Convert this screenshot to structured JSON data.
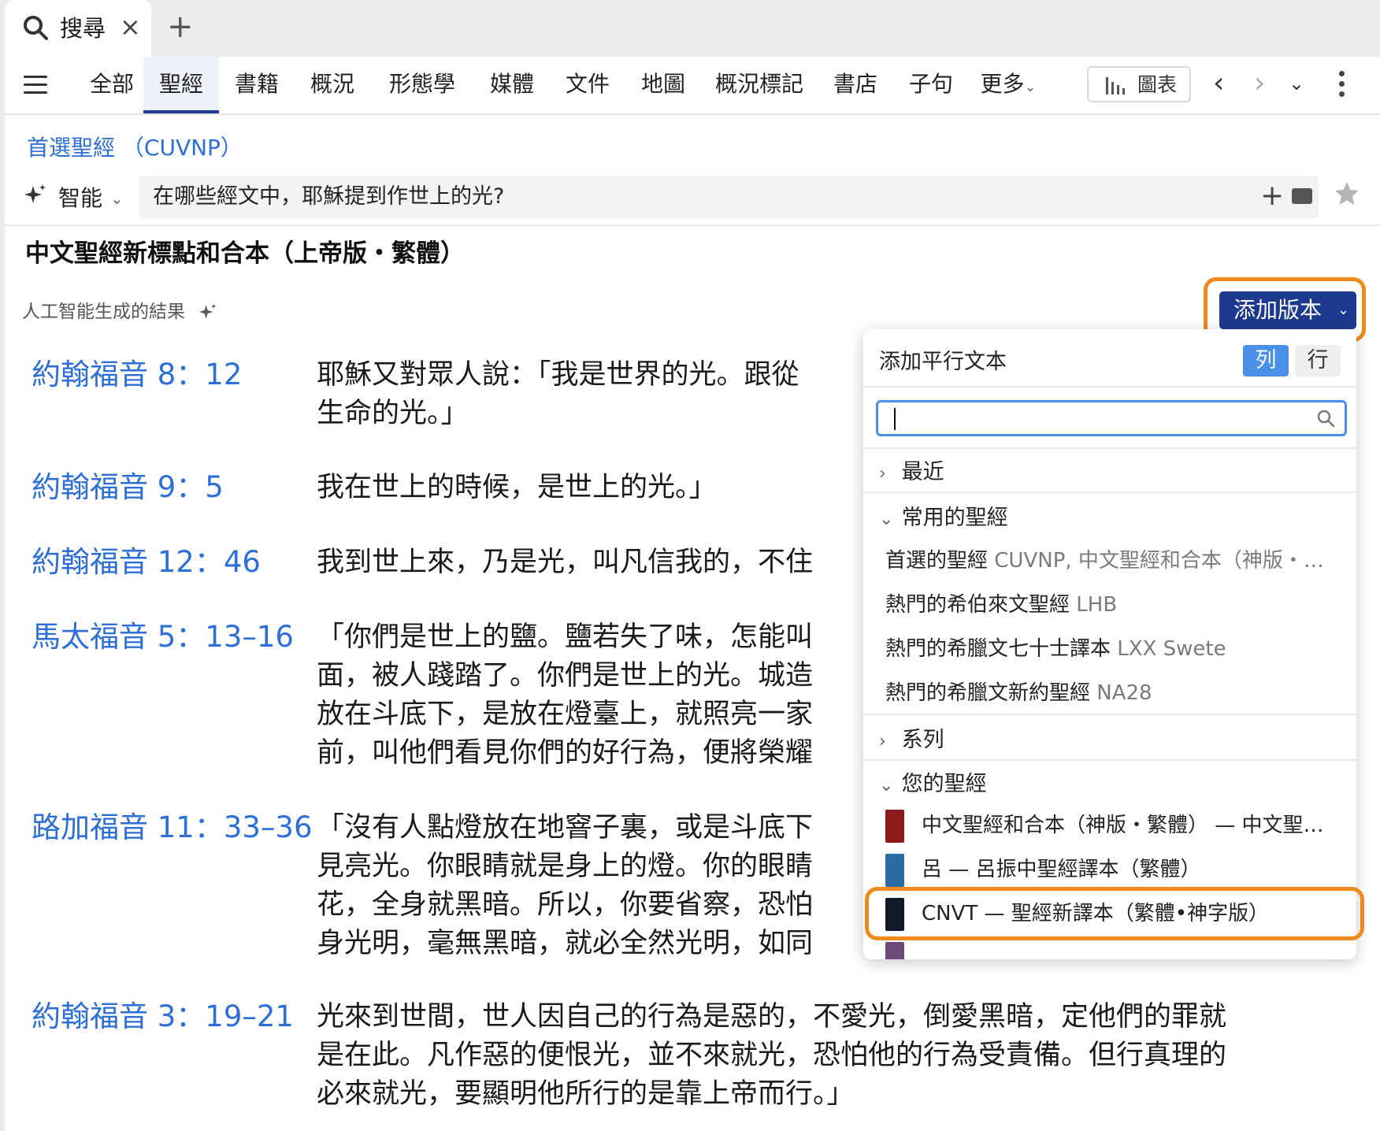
{
  "tab": {
    "label": "搜尋",
    "close": "×",
    "add": "+"
  },
  "nav": {
    "items": [
      "全部",
      "聖經",
      "書籍",
      "概況",
      "形態學",
      "媒體",
      "文件",
      "地圖",
      "概況標記",
      "書店",
      "子句"
    ],
    "more": "更多",
    "more_chevron": "⌄",
    "chart_button": "圖表",
    "back": "‹",
    "forward": "›",
    "history": "⌄"
  },
  "preferred_bible": "首選聖經 （CUVNP）",
  "smart": {
    "label": "智能",
    "chevron": "⌄"
  },
  "query": {
    "text": "在哪些經文中，耶穌提到作世上的光?",
    "plus": "+"
  },
  "results": {
    "title": "中文聖經新標點和合本（上帝版・繁體）",
    "ai_label": "人工智能生成的結果",
    "add_version": "添加版本",
    "add_version_chevron": "⌄",
    "items": [
      {
        "ref": "約翰福音 8：12",
        "lines": [
          "耶穌又對眾人說：「我是世界的光。跟從",
          "生命的光。」"
        ]
      },
      {
        "ref": "約翰福音 9：5",
        "lines": [
          "我在世上的時候，是世上的光。」"
        ]
      },
      {
        "ref": "約翰福音 12：46",
        "lines": [
          "我到世上來，乃是光，叫凡信我的，不住"
        ]
      },
      {
        "ref": "馬太福音 5：13–16",
        "lines": [
          "「你們是世上的鹽。鹽若失了味，怎能叫",
          "面，被人踐踏了。你們是世上的光。城造",
          "放在斗底下，是放在燈臺上，就照亮一家",
          "前，叫他們看見你們的好行為，便將榮耀"
        ]
      },
      {
        "ref": "路加福音 11：33–36",
        "lines": [
          "「沒有人點燈放在地窨子裏，或是斗底下",
          "見亮光。你眼睛就是身上的燈。你的眼睛",
          "花，全身就黑暗。所以，你要省察，恐怕",
          "身光明，毫無黑暗，就必全然光明，如同"
        ]
      },
      {
        "ref": "約翰福音 3：19–21",
        "lines": [
          "光來到世間，世人因自己的行為是惡的，不愛光，倒愛黑暗，定他們的罪就",
          "是在此。凡作惡的便恨光，並不來就光，恐怕他的行為受責備。但行真理的",
          "必來就光，要顯明他所行的是靠上帝而行。」"
        ]
      }
    ]
  },
  "panel": {
    "title": "添加平行文本",
    "seg_column": "列",
    "seg_row": "行",
    "search_value": "",
    "sections": {
      "recent": "最近",
      "common": "常用的聖經",
      "series": "系列",
      "yours": "您的聖經"
    },
    "common_items": [
      {
        "name": "首選的聖經",
        "detail": "CUVNP, 中文聖經和合本（神版・…"
      },
      {
        "name": "熱門的希伯來文聖經",
        "detail": "LHB"
      },
      {
        "name": "熱門的希臘文七十士譯本",
        "detail": "LXX Swete"
      },
      {
        "name": "熱門的希臘文新約聖經",
        "detail": "NA28"
      }
    ],
    "your_items": [
      {
        "text": "中文聖經和合本（神版・繁體） — 中文聖…",
        "cover": "#8b1a1a"
      },
      {
        "text": "呂 — 呂振中聖經譯本（繁體）",
        "cover": "#2b6ca3"
      },
      {
        "text": "CNVT — 聖經新譯本（繁體•神字版）",
        "cover": "#111827"
      }
    ]
  },
  "colors": {
    "accent": "#1d3a8f",
    "link": "#2d6fd6",
    "highlight": "#f08a1c"
  }
}
